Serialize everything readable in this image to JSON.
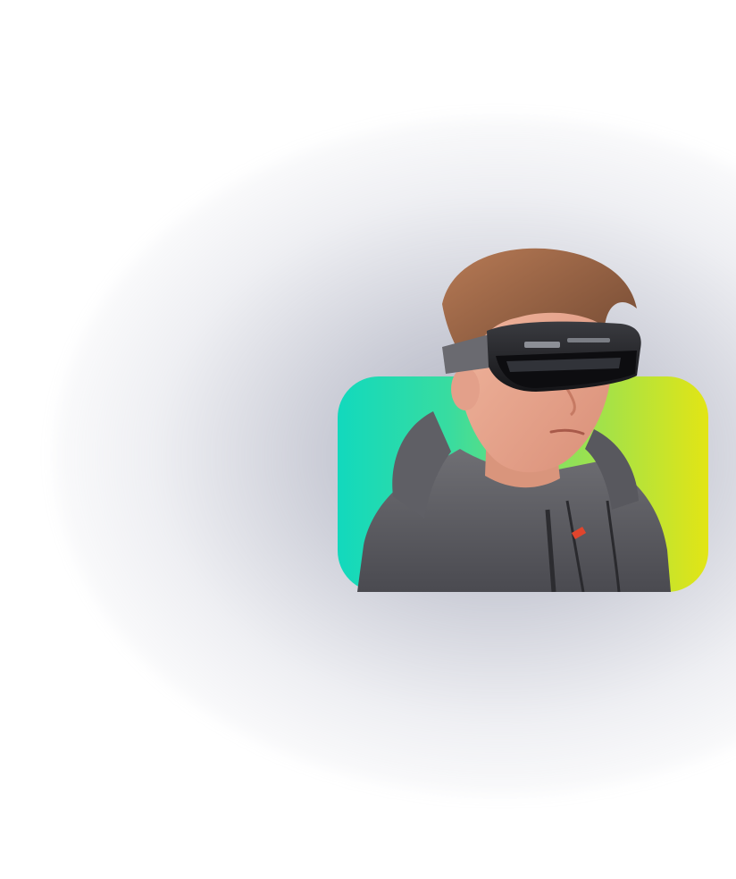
{
  "scene": {
    "background_color": "#ffffff",
    "glow_color": "#767a92",
    "card_gradient": [
      "#12d9bd",
      "#8ee15a",
      "#e2e515"
    ],
    "subject": "person-wearing-vr-headset"
  }
}
